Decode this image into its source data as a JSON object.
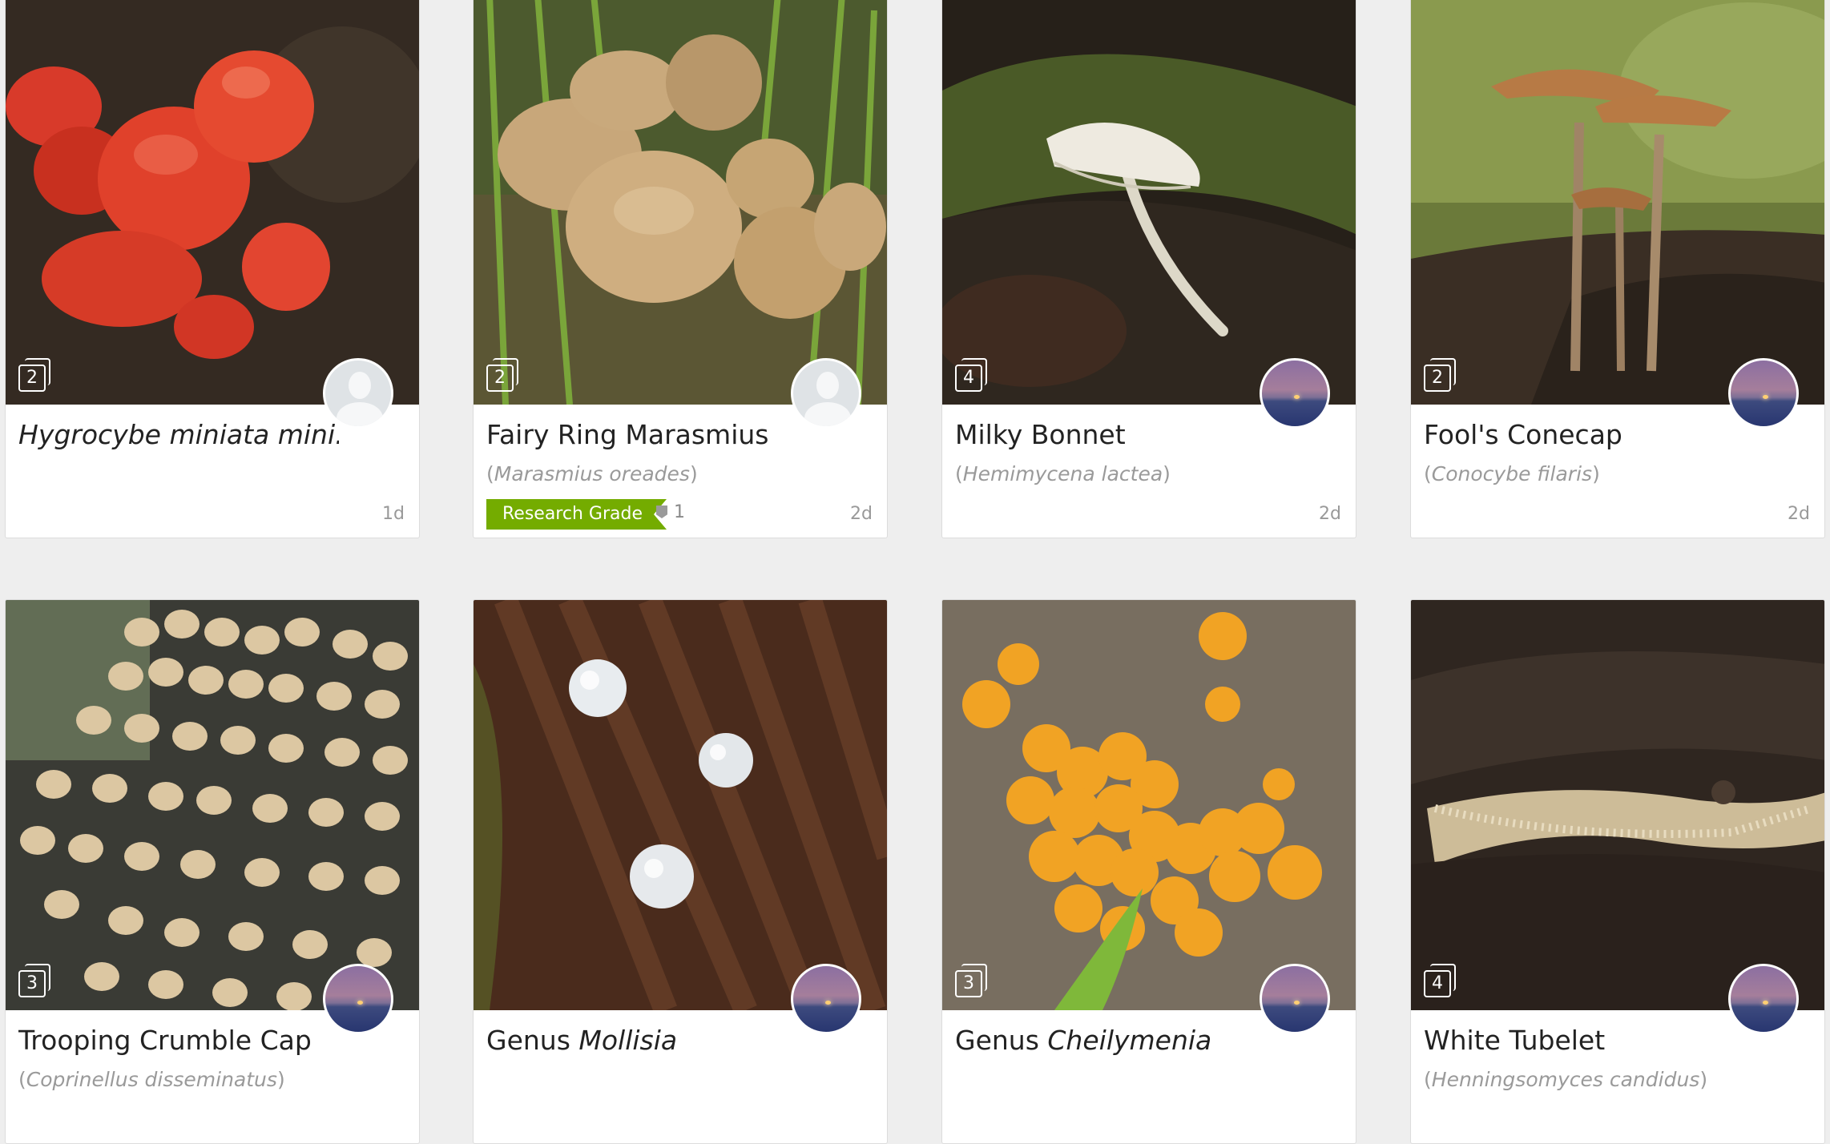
{
  "cards": [
    {
      "title_plain": "",
      "title_italic": "Hygrocybe miniata mini...",
      "sci_name": "",
      "photo_count": "2",
      "age": "1d",
      "avatar": "blank-avatar-icon"
    },
    {
      "title_plain": "Fairy Ring Marasmius",
      "title_italic": "",
      "sci_name": "Marasmius oreades",
      "photo_count": "2",
      "age": "2d",
      "avatar": "blank-avatar-icon",
      "quality": "Research Grade",
      "ids": "1"
    },
    {
      "title_plain": "Milky Bonnet",
      "title_italic": "",
      "sci_name": "Hemimycena lactea",
      "photo_count": "4",
      "age": "2d",
      "avatar": "sunset-avatar-icon"
    },
    {
      "title_plain": "Fool's Conecap",
      "title_italic": "",
      "sci_name": "Conocybe filaris",
      "photo_count": "2",
      "age": "2d",
      "avatar": "sunset-avatar-icon"
    },
    {
      "title_plain": "Trooping Crumble Cap",
      "title_italic": "",
      "sci_name": "Coprinellus disseminatus",
      "photo_count": "3",
      "age": "",
      "avatar": "sunset-avatar-icon"
    },
    {
      "title_plain": "Genus ",
      "title_italic": "Mollisia",
      "sci_name": "",
      "photo_count": "",
      "age": "",
      "avatar": "sunset-avatar-icon"
    },
    {
      "title_plain": "Genus ",
      "title_italic": "Cheilymenia",
      "sci_name": "",
      "photo_count": "3",
      "age": "",
      "avatar": "sunset-avatar-icon"
    },
    {
      "title_plain": "White Tubelet",
      "title_italic": "",
      "sci_name": "Henningsomyces candidus",
      "photo_count": "4",
      "age": "",
      "avatar": "sunset-avatar-icon"
    }
  ],
  "paren_open": "(",
  "paren_close": ")"
}
